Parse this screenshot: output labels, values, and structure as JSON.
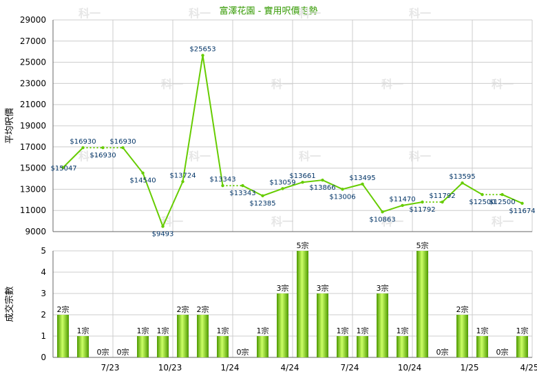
{
  "title": "富澤花園 - 實用呎價走勢",
  "watermark": "科一",
  "colors": {
    "line": "#66cc00",
    "line_dotted": "#66cc00",
    "title": "#339900",
    "label": "#003366",
    "bar_dark": "#4d9900",
    "bar_light": "#ccff66",
    "grid": "#cccccc",
    "axis": "#666666"
  },
  "x_tick_labels": [
    "7/23",
    "10/23",
    "1/24",
    "4/24",
    "7/24",
    "10/24",
    "1/25",
    "4/25"
  ],
  "chart_data": [
    {
      "type": "line",
      "title": "富澤花園 - 實用呎價走勢",
      "ylabel": "平均呎價",
      "ylim": [
        9000,
        29000
      ],
      "yticks": [
        9000,
        11000,
        13000,
        15000,
        17000,
        19000,
        21000,
        23000,
        25000,
        27000,
        29000
      ],
      "grid": true,
      "values": [
        15047,
        16930,
        16930,
        16930,
        14540,
        9493,
        13724,
        25653,
        13343,
        13343,
        12385,
        13059,
        13661,
        13866,
        13006,
        13495,
        10863,
        11470,
        11792,
        11792,
        13595,
        12500,
        12500,
        11674
      ],
      "point_labels": [
        "$15047",
        "$16930",
        "$16930",
        "$16930",
        "$14540",
        "$9493",
        "$13724",
        "$25653",
        "$13343",
        "$13343",
        "$12385",
        "$13059",
        "$13661",
        "$13866",
        "$13006",
        "$13495",
        "$10863",
        "$11470",
        "$11792",
        "$11792",
        "$13595",
        "$12500",
        "$12500",
        "$11674"
      ],
      "label_position": [
        "right",
        "above",
        "below",
        "above",
        "below",
        "below",
        "above",
        "above",
        "above",
        "below",
        "below",
        "above",
        "above",
        "below",
        "below",
        "above",
        "below",
        "above",
        "below",
        "above",
        "above",
        "below",
        "below",
        "below"
      ],
      "dotted_segments": [
        1,
        2,
        8,
        18,
        21
      ]
    },
    {
      "type": "bar",
      "ylabel": "成交宗數",
      "ylim": [
        0,
        5
      ],
      "yticks": [
        0,
        1,
        2,
        3,
        4,
        5
      ],
      "grid": true,
      "values": [
        2,
        1,
        0,
        0,
        1,
        1,
        2,
        2,
        1,
        0,
        1,
        3,
        5,
        3,
        1,
        1,
        3,
        1,
        5,
        0,
        2,
        1,
        0,
        1
      ],
      "bar_labels": [
        "2宗",
        "1宗",
        "0宗",
        "0宗",
        "1宗",
        "1宗",
        "2宗",
        "2宗",
        "1宗",
        "0宗",
        "1宗",
        "3宗",
        "5宗",
        "3宗",
        "1宗",
        "1宗",
        "3宗",
        "1宗",
        "5宗",
        "0宗",
        "2宗",
        "1宗",
        "0宗",
        "1宗"
      ]
    }
  ]
}
